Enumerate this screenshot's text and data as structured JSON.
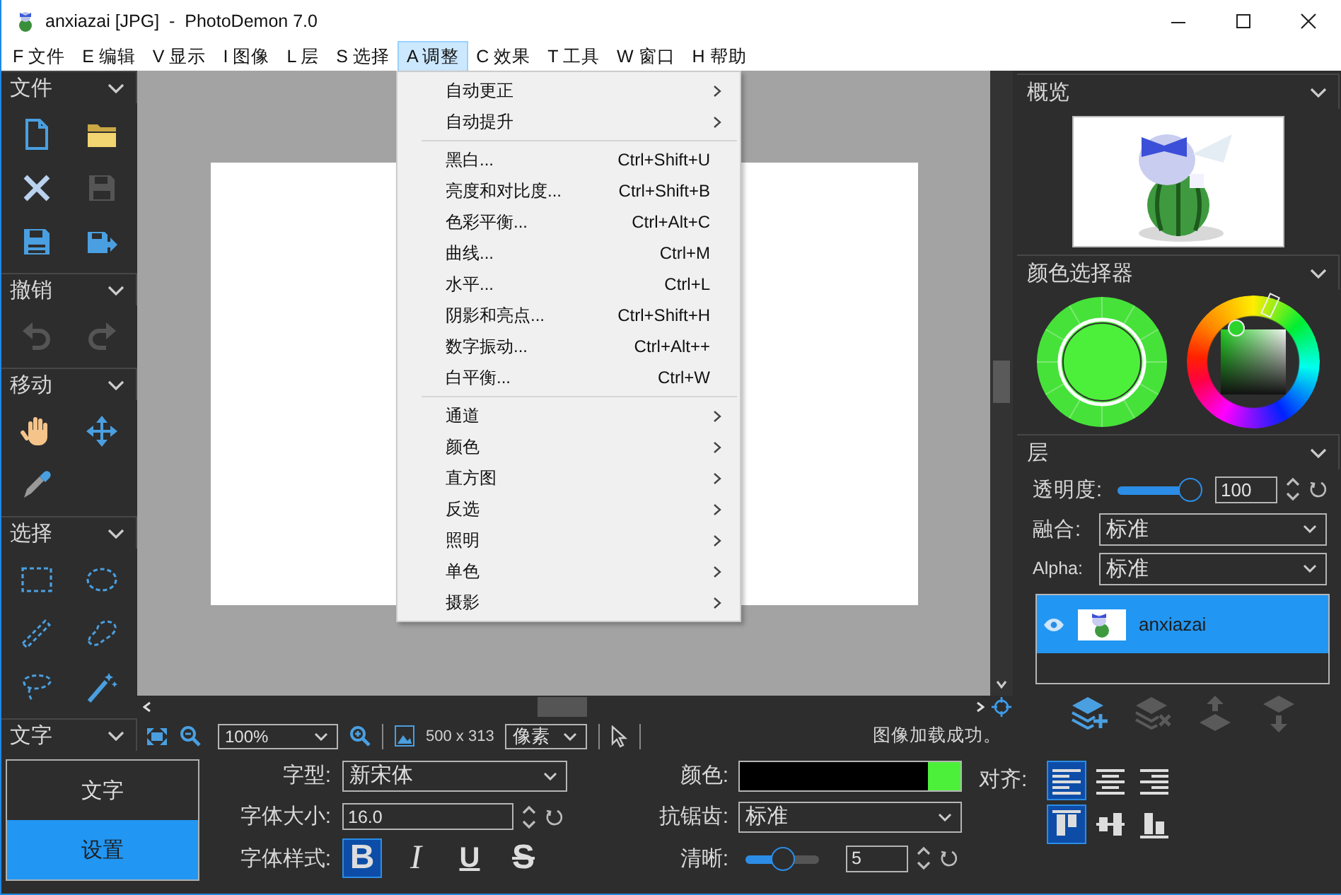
{
  "window": {
    "title": "anxiazai [JPG]  -  PhotoDemon 7.0"
  },
  "menu_bar": [
    {
      "label": "F 文件",
      "selected": false
    },
    {
      "label": "E 编辑",
      "selected": false
    },
    {
      "label": "V 显示",
      "selected": false
    },
    {
      "label": "I 图像",
      "selected": false
    },
    {
      "label": "L 层",
      "selected": false
    },
    {
      "label": "S 选择",
      "selected": false
    },
    {
      "label": "A 调整",
      "selected": true
    },
    {
      "label": "C 效果",
      "selected": false
    },
    {
      "label": "T 工具",
      "selected": false
    },
    {
      "label": "W 窗口",
      "selected": false
    },
    {
      "label": "H 帮助",
      "selected": false
    }
  ],
  "adjustments_menu": [
    {
      "kind": "submenu",
      "label": "自动更正"
    },
    {
      "kind": "submenu",
      "label": "自动提升"
    },
    {
      "kind": "separator"
    },
    {
      "kind": "command",
      "label": "黑白...",
      "shortcut": "Ctrl+Shift+U"
    },
    {
      "kind": "command",
      "label": "亮度和对比度...",
      "shortcut": "Ctrl+Shift+B"
    },
    {
      "kind": "command",
      "label": "色彩平衡...",
      "shortcut": "Ctrl+Alt+C"
    },
    {
      "kind": "command",
      "label": "曲线...",
      "shortcut": "Ctrl+M"
    },
    {
      "kind": "command",
      "label": "水平...",
      "shortcut": "Ctrl+L"
    },
    {
      "kind": "command",
      "label": "阴影和亮点...",
      "shortcut": "Ctrl+Shift+H"
    },
    {
      "kind": "command",
      "label": "数字振动...",
      "shortcut": "Ctrl+Alt++"
    },
    {
      "kind": "command",
      "label": "白平衡...",
      "shortcut": "Ctrl+W"
    },
    {
      "kind": "separator"
    },
    {
      "kind": "submenu",
      "label": "通道"
    },
    {
      "kind": "submenu",
      "label": "颜色"
    },
    {
      "kind": "submenu",
      "label": "直方图"
    },
    {
      "kind": "submenu",
      "label": "反选"
    },
    {
      "kind": "submenu",
      "label": "照明"
    },
    {
      "kind": "submenu",
      "label": "单色"
    },
    {
      "kind": "submenu",
      "label": "摄影"
    }
  ],
  "toolbox": {
    "sections": [
      {
        "title": "文件",
        "tools": [
          {
            "disabled": false
          },
          {
            "disabled": false
          },
          {
            "disabled": false
          },
          {
            "disabled": true
          },
          {
            "disabled": false
          },
          {
            "disabled": false
          }
        ]
      },
      {
        "title": "撤销",
        "tools": [
          {
            "disabled": true
          },
          {
            "disabled": true
          }
        ]
      },
      {
        "title": "移动",
        "tools": [
          {
            "disabled": false
          },
          {
            "disabled": false
          },
          {
            "disabled": false
          }
        ]
      },
      {
        "title": "选择",
        "tools": [
          {
            "disabled": false
          },
          {
            "disabled": false
          },
          {
            "disabled": false
          },
          {
            "disabled": false
          },
          {
            "disabled": false
          },
          {
            "disabled": false
          }
        ]
      },
      {
        "title": "文字"
      }
    ]
  },
  "status_bar": {
    "zoom": "100%",
    "image_size": "500 x 313",
    "unit": "像素",
    "message": "图像加载成功。"
  },
  "right_panel": {
    "overview_title": "概览",
    "color_picker_title": "颜色选择器",
    "layers_title": "层",
    "opacity_label": "透明度:",
    "opacity": {
      "level": 1.0,
      "value": "100"
    },
    "blend_label": "融合:",
    "blend_value": "标准",
    "alpha_label": "Alpha:",
    "alpha_value": "标准",
    "layers": [
      {
        "name": "anxiazai",
        "selected": true,
        "visible": true
      }
    ],
    "layer_actions": [
      {
        "disabled": false
      },
      {
        "disabled": true
      },
      {
        "disabled": true
      },
      {
        "disabled": true
      }
    ]
  },
  "text_options": {
    "tabs": [
      {
        "label": "文字",
        "selected": false
      },
      {
        "label": "设置",
        "selected": true
      }
    ],
    "font_label": "字型:",
    "font_value": "新宋体",
    "size_label": "字体大小:",
    "size_value": "16.0",
    "style_label": "字体样式:",
    "styles": [
      {
        "label": "B",
        "selected": true
      },
      {
        "label": "I",
        "selected": false
      },
      {
        "label": "U",
        "selected": false
      },
      {
        "label": "S",
        "selected": false
      }
    ],
    "color_label": "颜色:",
    "antialias_label": "抗锯齿:",
    "antialias_value": "标准",
    "clarity_label": "清晰:",
    "clarity": {
      "level": 0.5,
      "value": "5"
    },
    "align_label": "对齐:",
    "horizontal_align": [
      {
        "selected": true
      },
      {
        "selected": false
      },
      {
        "selected": false
      }
    ],
    "vertical_align": [
      {
        "selected": true
      },
      {
        "selected": false
      },
      {
        "selected": false
      }
    ]
  }
}
